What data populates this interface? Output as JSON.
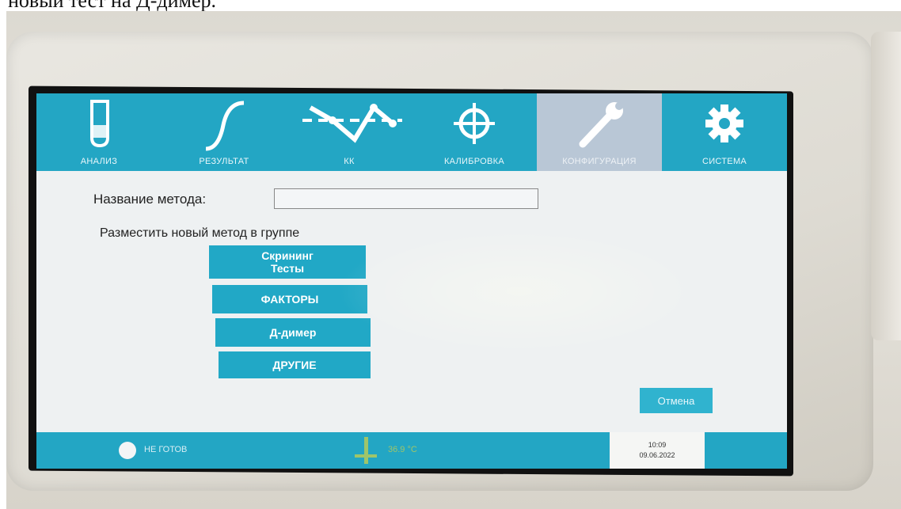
{
  "caption": "новый тест на Д-димер.",
  "tabs": [
    {
      "label": "АНАЛИЗ",
      "icon": "test-tube-icon",
      "active": false
    },
    {
      "label": "РЕЗУЛЬТАТ",
      "icon": "curve-icon",
      "active": false
    },
    {
      "label": "КК",
      "icon": "qc-chart-icon",
      "active": false
    },
    {
      "label": "КАЛИБРОВКА",
      "icon": "crosshair-icon",
      "active": false
    },
    {
      "label": "КОНФИГУРАЦИЯ",
      "icon": "wrench-icon",
      "active": true
    },
    {
      "label": "СИСТЕМА",
      "icon": "gear-icon",
      "active": false
    }
  ],
  "form": {
    "name_label": "Название метода:",
    "name_value": "",
    "group_label": "Разместить новый метод в группе"
  },
  "groups": {
    "screening_line1": "Скрининг",
    "screening_line2": "Тесты",
    "factors": "ФАКТОРЫ",
    "ddimer": "Д-димер",
    "other": "ДРУГИЕ"
  },
  "cancel_label": "Отмена",
  "status": {
    "state": "НЕ ГОТОВ",
    "temperature": "36.9 °C",
    "time": "10:09",
    "date": "09.06.2022"
  },
  "colors": {
    "accent": "#23a6c4",
    "active_tab": "#b9c7d6",
    "screen_bg": "#eef1f2"
  }
}
